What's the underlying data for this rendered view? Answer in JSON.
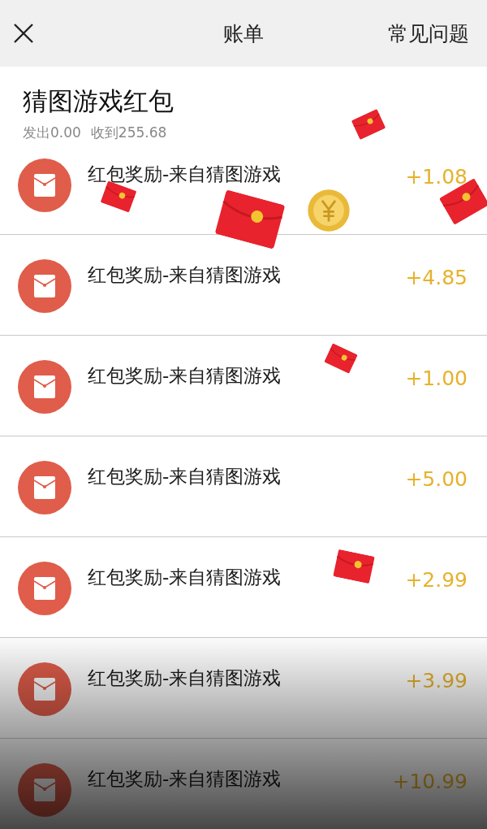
{
  "header": {
    "title": "账单",
    "help_link": "常见问题"
  },
  "summary": {
    "title": "猜图游戏红包",
    "sent": "发出0.00",
    "received": "收到255.68"
  },
  "transactions": [
    {
      "title": "红包奖励-来自猜图游戏",
      "amount": "+1.08"
    },
    {
      "title": "红包奖励-来自猜图游戏",
      "amount": "+4.85"
    },
    {
      "title": "红包奖励-来自猜图游戏",
      "amount": "+1.00"
    },
    {
      "title": "红包奖励-来自猜图游戏",
      "amount": "+5.00"
    },
    {
      "title": "红包奖励-来自猜图游戏",
      "amount": "+2.99"
    },
    {
      "title": "红包奖励-来自猜图游戏",
      "amount": "+3.99"
    },
    {
      "title": "红包奖励-来自猜图游戏",
      "amount": "+10.99"
    }
  ]
}
